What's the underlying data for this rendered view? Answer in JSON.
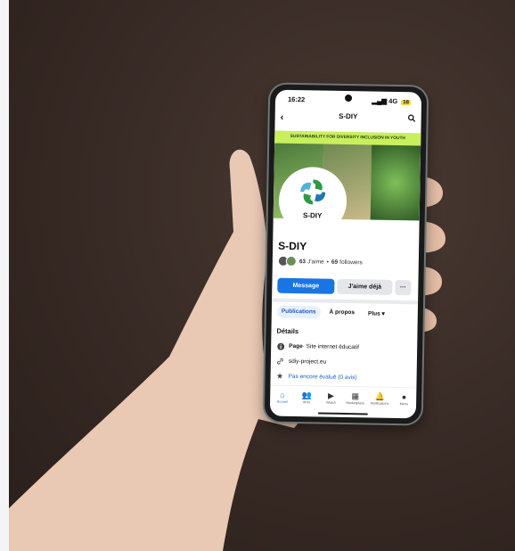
{
  "status": {
    "time": "16:22",
    "network": "4G",
    "battery": "18"
  },
  "topbar": {
    "title": "S-DIY",
    "back_icon": "chevron-left-icon",
    "search_icon": "search-icon"
  },
  "cover": {
    "banner": "SUSTAINABILITY FOR DIVERSITY INCLUSION IN YOUTH"
  },
  "logo": {
    "text": "S-DIY"
  },
  "page": {
    "name": "S-DIY",
    "likes_count": "63",
    "likes_label": "J'aime",
    "separator": "•",
    "followers_count": "69",
    "followers_label": "followers"
  },
  "buttons": {
    "message": "Message",
    "liked": "J'aime déjà",
    "more": "···"
  },
  "tabs": [
    {
      "label": "Publications",
      "active": true
    },
    {
      "label": "À propos",
      "active": false
    },
    {
      "label": "Plus ▾",
      "active": false
    }
  ],
  "details": {
    "heading": "Détails",
    "category_label": "Page",
    "category_value": " · Site internet éducatif",
    "website": "sdiy-project.eu",
    "rating": "Pas encore évalué (0 avis)"
  },
  "nav": [
    {
      "label": "Accueil",
      "icon": "home-icon",
      "active": true
    },
    {
      "label": "Amis",
      "icon": "friends-icon",
      "active": false
    },
    {
      "label": "Watch",
      "icon": "watch-icon",
      "active": false
    },
    {
      "label": "Marketplace",
      "icon": "marketplace-icon",
      "active": false
    },
    {
      "label": "Notifications",
      "icon": "bell-icon",
      "active": false
    },
    {
      "label": "Menu",
      "icon": "avatar-icon",
      "active": false
    }
  ],
  "colors": {
    "accent": "#1b74e4",
    "banner": "#c9ef5c",
    "background": "#3a2c27"
  }
}
